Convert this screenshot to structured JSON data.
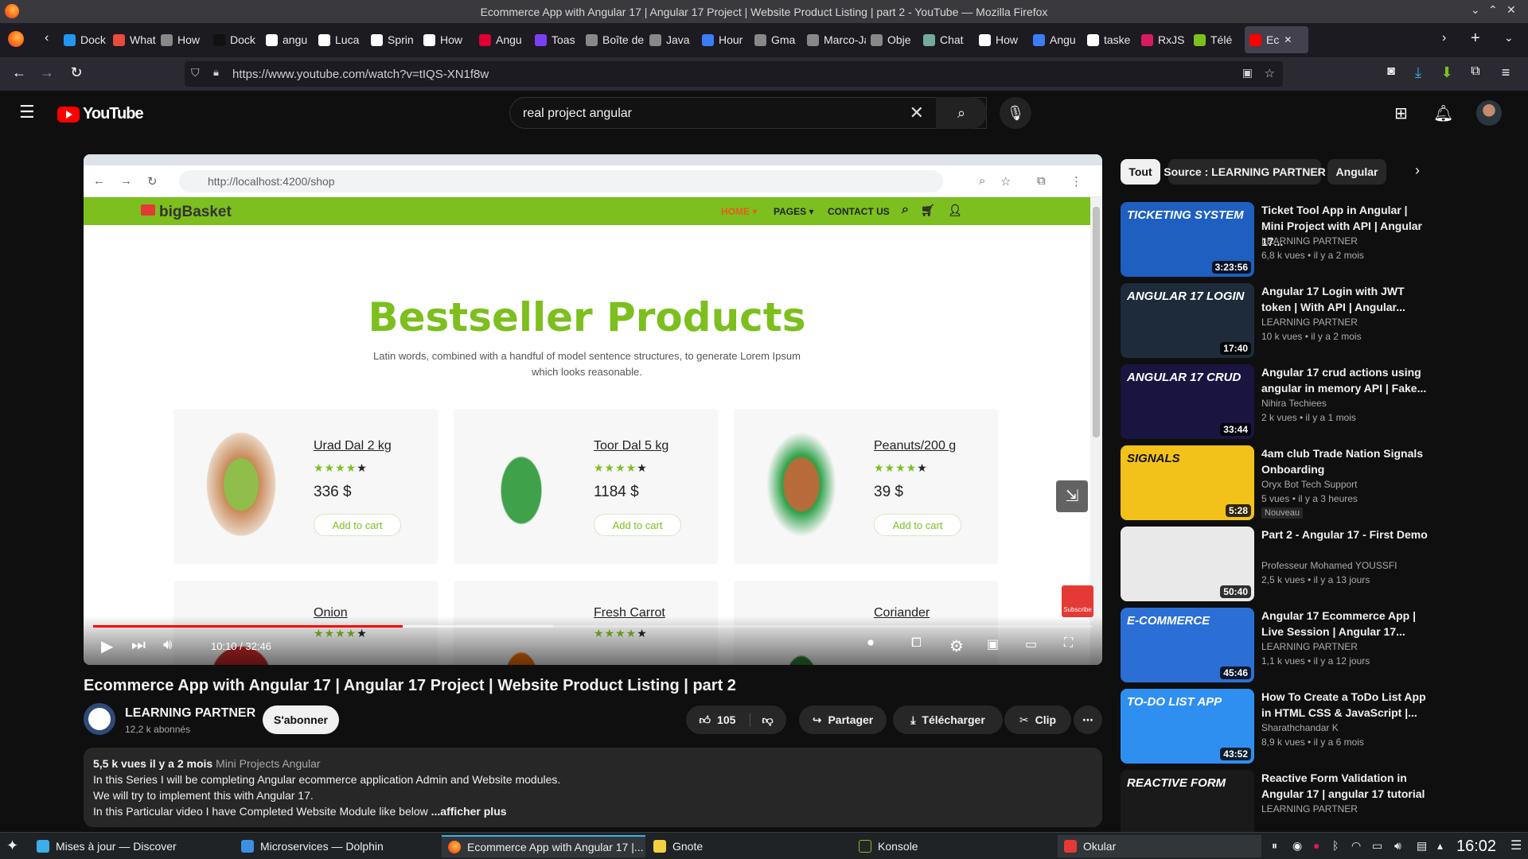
{
  "window": {
    "title": "Ecommerce App with Angular 17 | Angular 17 Project | Website Product Listing | part 2 - YouTube — Mozilla Firefox"
  },
  "browser_tabs": [
    {
      "label": "Dock",
      "color": "#2496ed"
    },
    {
      "label": "What",
      "color": "#e74c3c"
    },
    {
      "label": "How",
      "color": "#888888"
    },
    {
      "label": "Dock",
      "color": "#111111"
    },
    {
      "label": "angu",
      "color": "#ffffff"
    },
    {
      "label": "Luca",
      "color": "#ffffff"
    },
    {
      "label": "Sprin",
      "color": "#ffffff"
    },
    {
      "label": "How",
      "color": "#ffffff"
    },
    {
      "label": "Angu",
      "color": "#dd0031"
    },
    {
      "label": "Toas",
      "color": "#7a3ff2"
    },
    {
      "label": "Boîte de",
      "color": "#888888"
    },
    {
      "label": "Java",
      "color": "#888888"
    },
    {
      "label": "Hour",
      "color": "#3d7cf7"
    },
    {
      "label": "Gma",
      "color": "#888888"
    },
    {
      "label": "Marco-Ja",
      "color": "#888888"
    },
    {
      "label": "Obje",
      "color": "#888888"
    },
    {
      "label": "Chat",
      "color": "#74aa9c"
    },
    {
      "label": "How",
      "color": "#ffffff"
    },
    {
      "label": "Angu",
      "color": "#3d7cf7"
    },
    {
      "label": "taske",
      "color": "#ffffff"
    },
    {
      "label": "RxJS",
      "color": "#d81b60"
    },
    {
      "label": "Télé",
      "color": "#7cbf1e"
    },
    {
      "label": "Ec",
      "color": "#ff0000"
    }
  ],
  "url": "https://www.youtube.com/watch?v=tIQS-XN1f8w",
  "search": {
    "query": "real project angular"
  },
  "video": {
    "inner_url": "http://localhost:4200/shop",
    "brand": "bigBasket",
    "nav": {
      "home": "HOME ▾",
      "pages": "PAGES ▾",
      "contact": "CONTACT US"
    },
    "heading": "Bestseller Products",
    "subheading": "Latin words, combined with a handful of model sentence structures, to generate Lorem Ipsum which looks reasonable.",
    "products": [
      {
        "name": "Urad Dal 2 kg",
        "price": "336 $",
        "stars": "★★★★",
        "star_off": "★",
        "button": "Add to cart"
      },
      {
        "name": "Toor Dal 5 kg",
        "price": "1184 $",
        "stars": "★★★★",
        "star_off": "★",
        "button": "Add to cart"
      },
      {
        "name": "Peanuts/200 g",
        "price": "39 $",
        "stars": "★★★★",
        "star_off": "★",
        "button": "Add to cart"
      },
      {
        "name": "Onion",
        "stars": "★★★★",
        "star_off": "★"
      },
      {
        "name": "Fresh Carrot",
        "stars": "★★★★",
        "star_off": "★"
      },
      {
        "name": "Coriander"
      }
    ],
    "time": "10:10 / 32:46",
    "progress_fraction": 0.31,
    "subscribe_badge": "Subscribe",
    "title": "Ecommerce App with Angular 17 | Angular 17 Project | Website Product Listing | part 2"
  },
  "channel": {
    "name": "LEARNING PARTNER",
    "subs": "12,2 k abonnés",
    "subscribe": "S'abonner"
  },
  "actions": {
    "likes": "105",
    "share": "Partager",
    "download": "Télécharger",
    "clip": "Clip"
  },
  "description": {
    "meta": "5,5 k vues  il y a 2 mois",
    "tag": "Mini Projects Angular",
    "line1": "In this Series I will be completing Angular ecommerce application Admin and Website modules.",
    "line2": "We will try to implement this with Angular 17.",
    "line3": "In this Particular video I have Completed Website Module like below",
    "more": "...afficher plus"
  },
  "chips": [
    "Tout",
    "Source : LEARNING PARTNER",
    "Angular"
  ],
  "recommendations": [
    {
      "title": "Ticket Tool App in Angular | Mini Project with API | Angular 17...",
      "channel": "LEARNING PARTNER",
      "views": "6,8 k vues  • il y a 2 mois",
      "duration": "3:23:56",
      "thumb_text": "TICKETING SYSTEM",
      "bg": "#1e5fbf"
    },
    {
      "title": "Angular 17 Login with JWT token | With API | Angular...",
      "channel": "LEARNING PARTNER",
      "views": "10 k vues  • il y a 2 mois",
      "duration": "17:40",
      "thumb_text": "ANGULAR 17 LOGIN",
      "bg": "#1d2b3a"
    },
    {
      "title": "Angular 17 crud actions using angular in memory API | Fake...",
      "channel": "Nihira Techiees",
      "views": "2 k vues  • il y a 1 mois",
      "duration": "33:44",
      "thumb_text": "ANGULAR 17 CRUD",
      "bg": "#1a1440"
    },
    {
      "title": "4am club Trade Nation Signals Onboarding",
      "channel": "Oryx Bot Tech Support",
      "views": "5 vues  • il y a 3 heures",
      "duration": "5:28",
      "thumb_text": "SIGNALS",
      "bg": "#f2c21b",
      "badge": "Nouveau"
    },
    {
      "title": "Part 2 - Angular 17 - First Demo",
      "channel": "Professeur Mohamed YOUSSFI",
      "views": "2,5 k vues  • il y a 13 jours",
      "duration": "50:40",
      "thumb_text": "",
      "bg": "#e9e9e9"
    },
    {
      "title": "Angular 17 Ecommerce App | Live Session | Angular 17...",
      "channel": "LEARNING PARTNER",
      "views": "1,1 k vues  • il y a 12 jours",
      "duration": "45:46",
      "thumb_text": "E-COMMERCE",
      "bg": "#2b6fd6"
    },
    {
      "title": "How To Create a ToDo List App in HTML CSS & JavaScript |...",
      "channel": "Sharathchandar K",
      "views": "8,9 k vues  • il y a 6 mois",
      "duration": "43:52",
      "thumb_text": "TO-DO LIST APP",
      "bg": "#2f8ff0"
    },
    {
      "title": "Reactive Form Validation in Angular 17 | angular 17 tutorial",
      "channel": "LEARNING PARTNER",
      "views": "",
      "duration": "",
      "thumb_text": "REACTIVE FORM",
      "bg": "#1a1a1a"
    }
  ],
  "taskbar": {
    "tasks": [
      "Mises à jour — Discover",
      "Microservices — Dolphin",
      "Ecommerce App with Angular 17 |...",
      "Gnote",
      "Konsole",
      "Okular"
    ],
    "clock": "16:02"
  }
}
